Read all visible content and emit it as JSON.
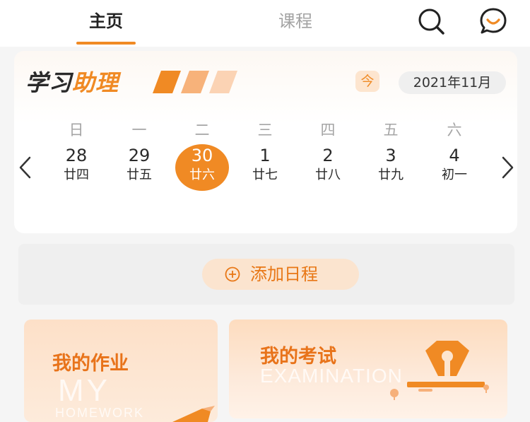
{
  "header": {
    "tabs": [
      {
        "label": "主页",
        "active": true
      },
      {
        "label": "课程",
        "active": false
      }
    ],
    "icons": [
      "search-icon",
      "message-icon"
    ]
  },
  "assistant": {
    "brand_part1": "学习",
    "brand_part2": "助理",
    "today_label": "今",
    "month_label": "2021年11月"
  },
  "calendar": {
    "weekdays": [
      "日",
      "一",
      "二",
      "三",
      "四",
      "五",
      "六"
    ],
    "days": [
      {
        "num": "28",
        "lunar": "廿四"
      },
      {
        "num": "29",
        "lunar": "廿五"
      },
      {
        "num": "30",
        "lunar": "廿六",
        "selected": true
      },
      {
        "num": "1",
        "lunar": "廿七"
      },
      {
        "num": "2",
        "lunar": "廿八"
      },
      {
        "num": "3",
        "lunar": "廿九"
      },
      {
        "num": "4",
        "lunar": "初一"
      }
    ]
  },
  "schedule": {
    "add_label": "添加日程"
  },
  "cards": {
    "homework": {
      "title": "我的作业",
      "bg_word": "MY",
      "bg_word2": "HOMEWORK"
    },
    "exam": {
      "title": "我的考试",
      "bg_word": "EXAMINATION"
    }
  },
  "colors": {
    "accent": "#f08a24",
    "accent_light": "#fbe4cf",
    "muted_text": "#a5a5a5",
    "panel_gray": "#efefef"
  }
}
